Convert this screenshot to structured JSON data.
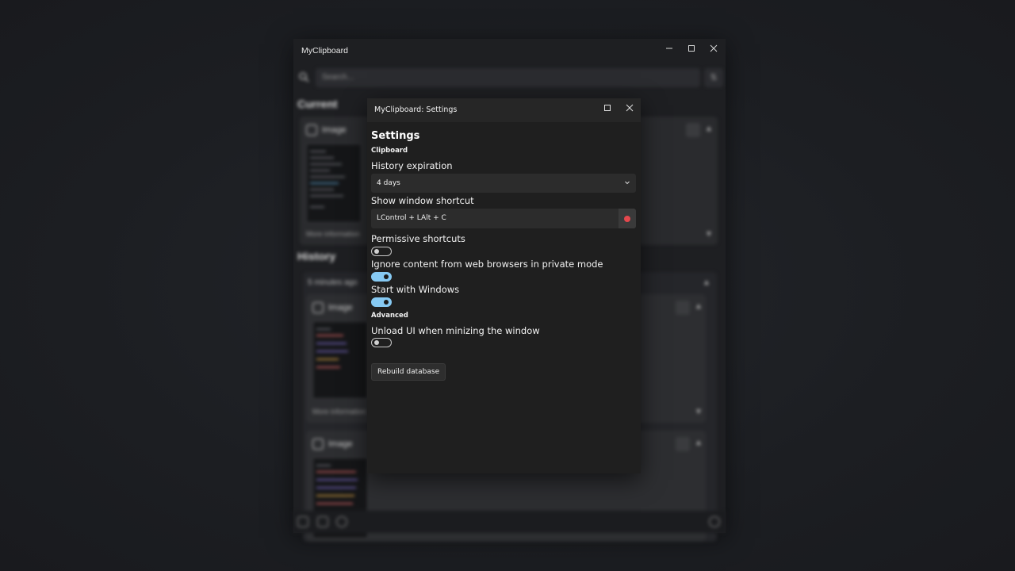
{
  "main_window": {
    "title": "MyClipboard",
    "search_placeholder": "Search...",
    "sections": {
      "current": "Current",
      "history": "History"
    },
    "current_card": {
      "type_label": "Image",
      "more_info": "More information"
    },
    "history_group": {
      "time_label": "5 minutes ago",
      "cards": [
        {
          "type_label": "Image",
          "more_info": "More information"
        },
        {
          "type_label": "Image"
        }
      ]
    }
  },
  "settings": {
    "window_title": "MyClipboard: Settings",
    "heading": "Settings",
    "clipboard_section": "Clipboard",
    "history_expiration": {
      "label": "History expiration",
      "value": "4 days"
    },
    "show_window_shortcut": {
      "label": "Show window shortcut",
      "value": "LControl + LAlt + C"
    },
    "permissive_shortcuts": {
      "label": "Permissive shortcuts",
      "enabled": false
    },
    "ignore_private": {
      "label": "Ignore content from web browsers in private mode",
      "enabled": true
    },
    "start_with_windows": {
      "label": "Start with Windows",
      "enabled": true
    },
    "advanced_section": "Advanced",
    "unload_ui": {
      "label": "Unload UI when minizing the window",
      "enabled": false
    },
    "rebuild_button": "Rebuild database"
  },
  "colors": {
    "accent_toggle": "#86c9f2",
    "record_dot": "#e5484d",
    "dialog_bg": "#1f1f1f",
    "desktop_bg": "#1c1e22"
  }
}
